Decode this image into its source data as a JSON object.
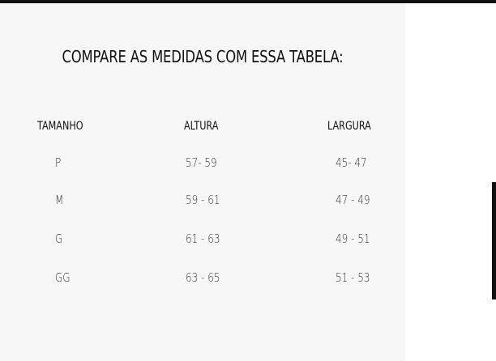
{
  "table_title": "COMPARE AS MEDIDAS COM ESSA TABELA:",
  "columns": [
    "TAMANHO",
    "ALTURA",
    "LARGURA"
  ],
  "rows": [
    {
      "tamanho": "P",
      "altura": "57- 59",
      "largura": "45- 47"
    },
    {
      "tamanho": "M",
      "altura": "59 - 61",
      "largura": "47 - 49"
    },
    {
      "tamanho": "G",
      "altura": "61 - 63",
      "largura": "49 - 51"
    },
    {
      "tamanho": "GG",
      "altura": "63 - 65",
      "largura": "51 - 53"
    }
  ]
}
